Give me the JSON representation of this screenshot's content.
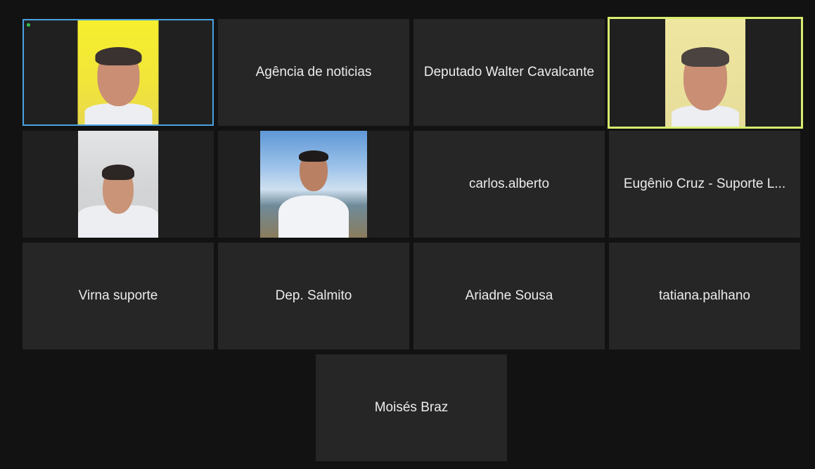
{
  "participants": [
    {
      "name": "",
      "type": "video",
      "variant": "yellow",
      "highlight": "blue"
    },
    {
      "name": "Agência de noticias",
      "type": "name"
    },
    {
      "name": "Deputado Walter Cavalcante",
      "type": "name"
    },
    {
      "name": "",
      "type": "video",
      "variant": "pale",
      "highlight": "green"
    },
    {
      "name": "",
      "type": "video",
      "variant": "room"
    },
    {
      "name": "",
      "type": "video",
      "variant": "sky"
    },
    {
      "name": "carlos.alberto",
      "type": "name"
    },
    {
      "name": "Eugênio Cruz - Suporte L...",
      "type": "name"
    },
    {
      "name": "Virna suporte",
      "type": "name"
    },
    {
      "name": "Dep. Salmito",
      "type": "name"
    },
    {
      "name": "Ariadne Sousa",
      "type": "name"
    },
    {
      "name": "tatiana.palhano",
      "type": "name"
    },
    {
      "name": "Moisés Braz",
      "type": "name"
    }
  ],
  "colors": {
    "background": "#121212",
    "tile": "#262626",
    "active_speaker_blue": "#4aa3e3",
    "active_speaker_green": "#d7ee70"
  }
}
